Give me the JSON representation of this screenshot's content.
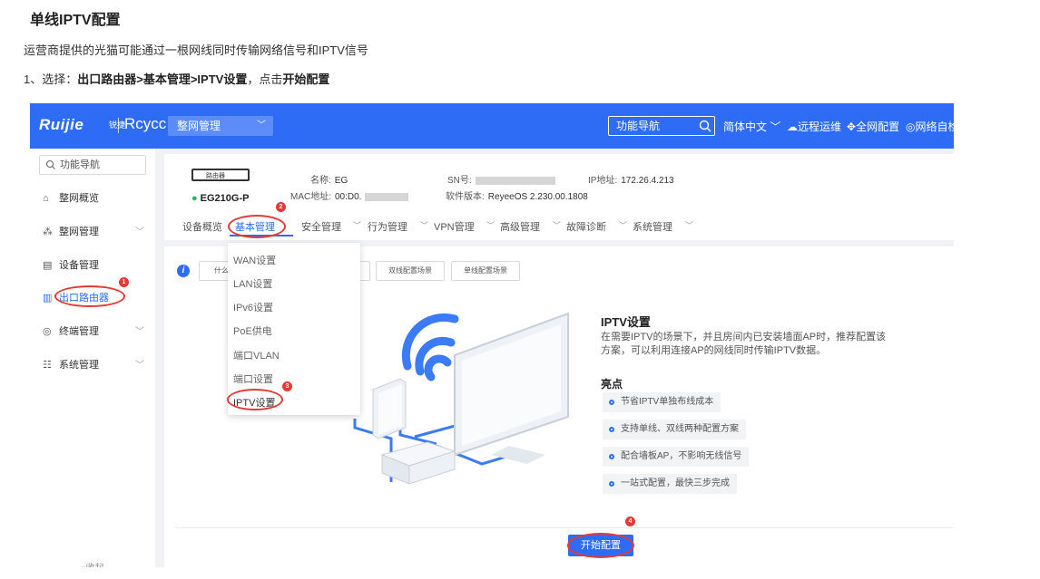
{
  "doc": {
    "title": "单线IPTV配置",
    "desc": "运营商提供的光猫可能通过一根网线同时传输网络信号和IPTV信号",
    "step_prefix": "1、选择：",
    "step_path": "出口路由器>基本管理>IPTV设置",
    "step_mid": "，点击",
    "step_action": "开始配置"
  },
  "topbar": {
    "logo": "Ruijie",
    "logo_sub": "锐捷",
    "brand": "Rcycc",
    "project": "整网管理",
    "func_search": "功能导航",
    "language": "简体中文",
    "remote_ops": "远程运维",
    "network_config": "全网配置",
    "self_check": "网络自检"
  },
  "sidebar": {
    "search": "功能导航",
    "items": [
      {
        "label": "整网概览",
        "icon": "home-icon"
      },
      {
        "label": "整网管理",
        "icon": "topology-icon"
      },
      {
        "label": "设备管理",
        "icon": "device-icon"
      },
      {
        "label": "出口路由器",
        "icon": "router-icon"
      },
      {
        "label": "终端管理",
        "icon": "terminal-icon"
      },
      {
        "label": "系统管理",
        "icon": "settings-icon"
      }
    ],
    "collapse": "«收起"
  },
  "device": {
    "type_label": "路由器",
    "model": "EG210G-P",
    "name_label": "名称:",
    "name_value": "EG",
    "mac_label": "MAC地址:",
    "mac_value": "00:D0.",
    "sn_label": "SN号:",
    "ip_label": "IP地址:",
    "ip_value": "172.26.4.213",
    "fw_label": "软件版本:",
    "fw_value": "ReyeeOS 2.230.00.1808"
  },
  "tabs": [
    "设备概览",
    "基本管理",
    "安全管理",
    "行为管理",
    "VPN管理",
    "高级管理",
    "故障诊断",
    "系统管理"
  ],
  "dropdown": [
    "WAN设置",
    "LAN设置",
    "IPv6设置",
    "PoE供电",
    "端口VLAN",
    "端口设置",
    "IPTV设置"
  ],
  "scene_buttons": [
    "什么",
    "双线配置场景",
    "单线配置场景"
  ],
  "feature": {
    "title": "IPTV设置",
    "desc": "在需要IPTV的场景下，并且房间内已安装墙面AP时，推荐配置该方案，可以利用连接AP的网线同时传输IPTV数据。",
    "highlights_title": "亮点",
    "highlights": [
      "节省IPTV单独布线成本",
      "支持单线、双线两种配置方案",
      "配合墙板AP，不影响无线信号",
      "一站式配置，最快三步完成"
    ]
  },
  "start_button": "开始配置",
  "markers": [
    "1",
    "2",
    "3",
    "4"
  ],
  "colors": {
    "primary": "#2e6cf6",
    "annotation": "#e53935",
    "online": "#19be6b"
  }
}
